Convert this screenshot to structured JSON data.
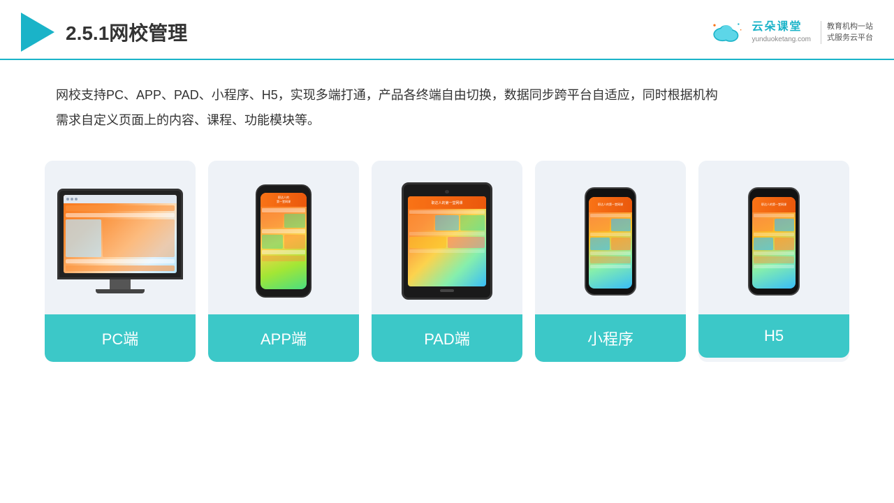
{
  "header": {
    "title": "2.5.1网校管理",
    "brand": {
      "name": "云朵课堂",
      "url": "yunduoketang.com",
      "slogan": "教育机构一站\n式服务云平台"
    }
  },
  "description": "网校支持PC、APP、PAD、小程序、H5，实现多端打通，产品各终端自由切换，数据同步跨平台自适应，同时根据机构\n需求自定义页面上的内容、课程、功能模块等。",
  "cards": [
    {
      "id": "pc",
      "label": "PC端"
    },
    {
      "id": "app",
      "label": "APP端"
    },
    {
      "id": "pad",
      "label": "PAD端"
    },
    {
      "id": "miniapp",
      "label": "小程序"
    },
    {
      "id": "h5",
      "label": "H5"
    }
  ],
  "colors": {
    "teal": "#3cc8c8",
    "accent": "#1ab3c8",
    "cardBg": "#eef2f7"
  }
}
